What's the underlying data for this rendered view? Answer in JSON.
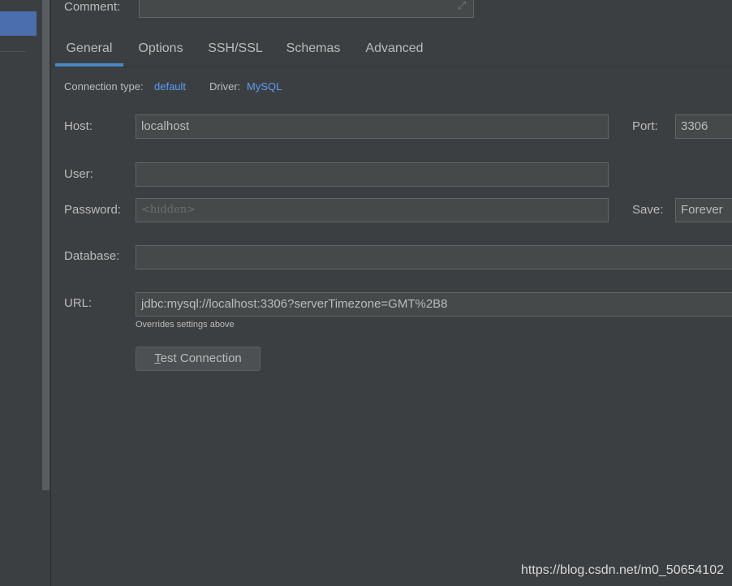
{
  "comment": {
    "label": "Comment:",
    "value": ""
  },
  "tabs": [
    {
      "label": "General",
      "active": true
    },
    {
      "label": "Options",
      "active": false
    },
    {
      "label": "SSH/SSL",
      "active": false
    },
    {
      "label": "Schemas",
      "active": false
    },
    {
      "label": "Advanced",
      "active": false
    }
  ],
  "connection": {
    "type_label": "Connection type:",
    "type_value": "default",
    "driver_label": "Driver:",
    "driver_value": "MySQL"
  },
  "host": {
    "label": "Host:",
    "value": "localhost"
  },
  "port": {
    "label": "Port:",
    "value": "3306"
  },
  "user": {
    "label": "User:",
    "value": ""
  },
  "password": {
    "label": "Password:",
    "placeholder": "<hidden>"
  },
  "save": {
    "label": "Save:",
    "value": "Forever"
  },
  "database": {
    "label": "Database:",
    "value": ""
  },
  "url": {
    "label": "URL:",
    "value": "jdbc:mysql://localhost:3306?serverTimezone=GMT%2B8",
    "note": "Overrides settings above"
  },
  "test_button": {
    "mnemonic": "T",
    "rest": "est Connection"
  },
  "watermark": "https://blog.csdn.net/m0_50654102",
  "colors": {
    "accent": "#4a88c7",
    "link": "#589df6",
    "selection": "#4b6eaf",
    "background": "#3c3f41"
  }
}
